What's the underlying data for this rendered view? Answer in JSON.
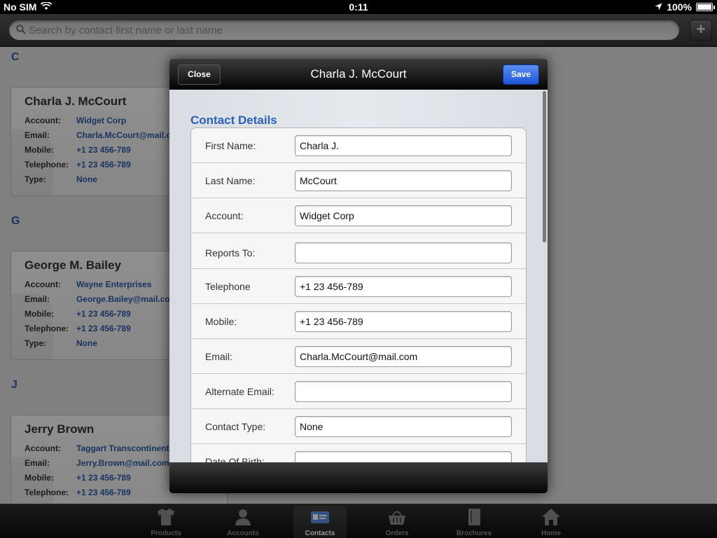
{
  "status_bar": {
    "carrier": "No SIM",
    "time": "0:11",
    "battery": "100%"
  },
  "search": {
    "placeholder": "Search by contact first name or last name",
    "add_label": "+"
  },
  "list": {
    "sections": [
      {
        "letter": "C",
        "contacts": [
          {
            "name": "Charla J. McCourt",
            "fields": [
              {
                "label": "Account:",
                "value": "Widget Corp"
              },
              {
                "label": "Email:",
                "value": "Charla.McCourt@mail.com"
              },
              {
                "label": "Mobile:",
                "value": "+1 23 456-789"
              },
              {
                "label": "Telephone:",
                "value": "+1 23 456-789"
              },
              {
                "label": "Type:",
                "value": "None"
              }
            ]
          }
        ]
      },
      {
        "letter": "G",
        "contacts": [
          {
            "name": "George M. Bailey",
            "fields": [
              {
                "label": "Account:",
                "value": "Wayne Enterprises"
              },
              {
                "label": "Email:",
                "value": "George.Bailey@mail.com"
              },
              {
                "label": "Mobile:",
                "value": "+1 23 456-789"
              },
              {
                "label": "Telephone:",
                "value": "+1 23 456-789"
              },
              {
                "label": "Type:",
                "value": "None"
              }
            ]
          }
        ]
      },
      {
        "letter": "J",
        "contacts": [
          {
            "name": "Jerry Brown",
            "fields": [
              {
                "label": "Account:",
                "value": "Taggart Transcontinental"
              },
              {
                "label": "Email:",
                "value": "Jerry.Brown@mail.com"
              },
              {
                "label": "Mobile:",
                "value": "+1 23 456-789"
              },
              {
                "label": "Telephone:",
                "value": "+1 23 456-789"
              }
            ]
          }
        ]
      }
    ]
  },
  "modal": {
    "title": "Charla J. McCourt",
    "close_label": "Close",
    "save_label": "Save",
    "section_title": "Contact Details",
    "fields": [
      {
        "label": "First Name:",
        "value": "Charla J."
      },
      {
        "label": "Last Name:",
        "value": "McCourt"
      },
      {
        "label": "Account:",
        "value": "Widget Corp"
      },
      {
        "label": "Reports To:",
        "value": ""
      },
      {
        "label": "Telephone",
        "value": "+1 23 456-789"
      },
      {
        "label": "Mobile:",
        "value": "+1 23 456-789"
      },
      {
        "label": "Email:",
        "value": "Charla.McCourt@mail.com"
      },
      {
        "label": "Alternate Email:",
        "value": ""
      },
      {
        "label": "Contact Type:",
        "value": "None"
      },
      {
        "label": "Date Of Birth:",
        "value": ""
      }
    ]
  },
  "tabbar": {
    "tabs": [
      {
        "label": "Products",
        "icon": "shirt-icon"
      },
      {
        "label": "Accounts",
        "icon": "person-icon"
      },
      {
        "label": "Contacts",
        "icon": "contact-card-icon",
        "active": true
      },
      {
        "label": "Orders",
        "icon": "basket-icon"
      },
      {
        "label": "Brochures",
        "icon": "brochure-icon"
      },
      {
        "label": "Home",
        "icon": "home-icon"
      }
    ]
  },
  "colors": {
    "accent_blue": "#2a5aa6",
    "save_button": "#2a62e0",
    "title_blue": "#2a63b5"
  }
}
